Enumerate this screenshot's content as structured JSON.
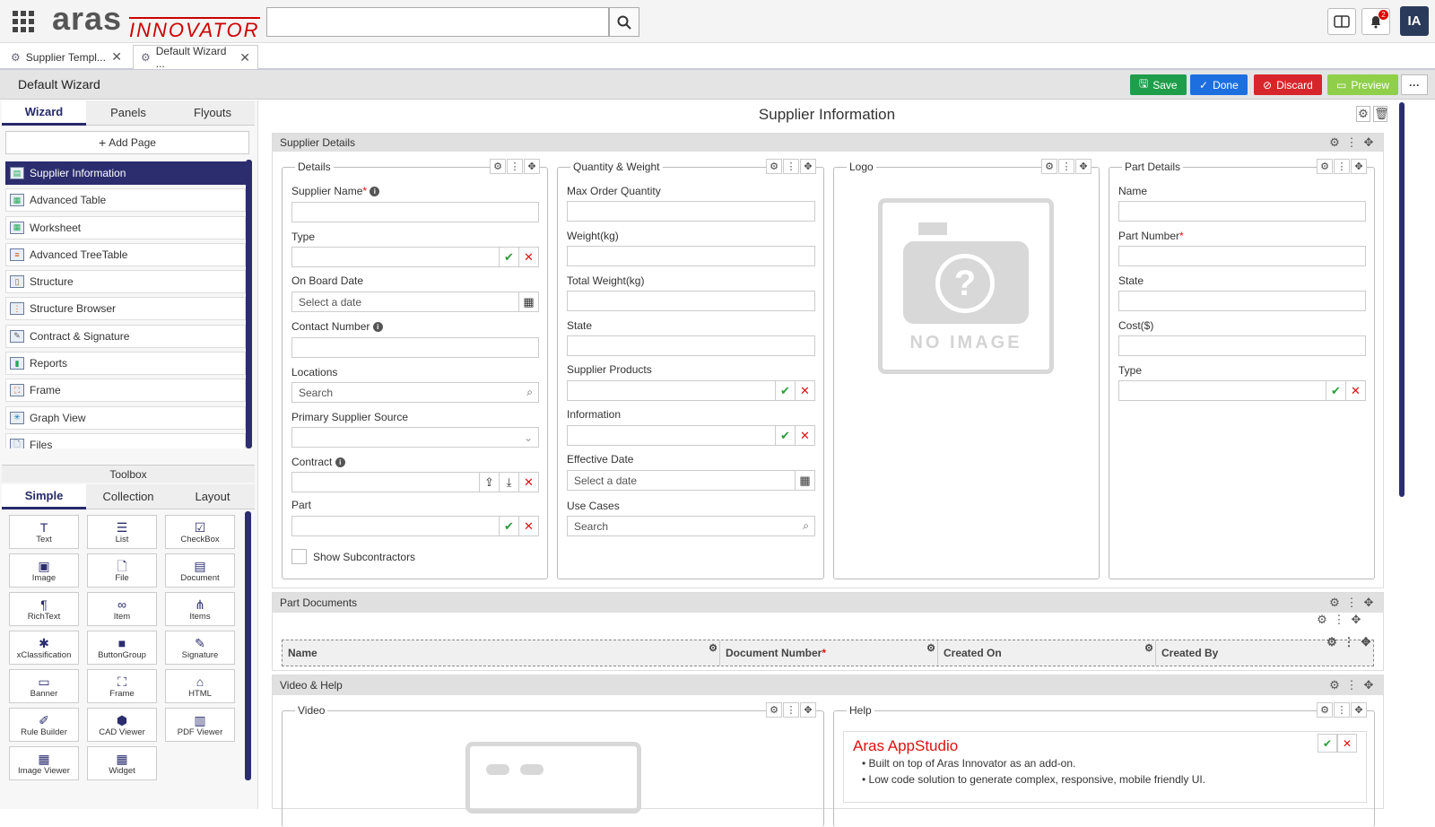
{
  "app": {
    "brand_main": "aras",
    "brand_sub": "INNOVATOR",
    "search_value": "",
    "notifications": "2",
    "user_initials": "IA"
  },
  "tabs": [
    {
      "label": "Supplier Templ..."
    },
    {
      "label": "Default Wizard ..."
    }
  ],
  "titlebar": {
    "title": "Default Wizard",
    "save": "Save",
    "done": "Done",
    "discard": "Discard",
    "preview": "Preview",
    "more": "···"
  },
  "left": {
    "tabs": [
      "Wizard",
      "Panels",
      "Flyouts"
    ],
    "add_page": "Add Page",
    "pages": [
      "Supplier Information",
      "Advanced Table",
      "Worksheet",
      "Advanced TreeTable",
      "Structure",
      "Structure Browser",
      "Contract & Signature",
      "Reports",
      "Frame",
      "Graph View",
      "Files"
    ],
    "toolbox": "Toolbox",
    "toolbox_tabs": [
      "Simple",
      "Collection",
      "Layout"
    ],
    "tools": [
      {
        "label": "Text",
        "icon": "T"
      },
      {
        "label": "List",
        "icon": "☰"
      },
      {
        "label": "CheckBox",
        "icon": "☑"
      },
      {
        "label": "Image",
        "icon": "▣"
      },
      {
        "label": "File",
        "icon": "🗋"
      },
      {
        "label": "Document",
        "icon": "▤"
      },
      {
        "label": "RichText",
        "icon": "¶"
      },
      {
        "label": "Item",
        "icon": "∞"
      },
      {
        "label": "Items",
        "icon": "⋔"
      },
      {
        "label": "xClassification",
        "icon": "✱"
      },
      {
        "label": "ButtonGroup",
        "icon": "■"
      },
      {
        "label": "Signature",
        "icon": "✎"
      },
      {
        "label": "Banner",
        "icon": "▭"
      },
      {
        "label": "Frame",
        "icon": "⛶"
      },
      {
        "label": "HTML",
        "icon": "⌂"
      },
      {
        "label": "Rule Builder",
        "icon": "✐"
      },
      {
        "label": "CAD Viewer",
        "icon": "⬢"
      },
      {
        "label": "PDF Viewer",
        "icon": "▥"
      },
      {
        "label": "Image Viewer",
        "icon": "▦"
      },
      {
        "label": "Widget",
        "icon": "▦"
      }
    ]
  },
  "main": {
    "page_title": "Supplier Information",
    "supplier_details": {
      "title": "Supplier Details",
      "details": {
        "legend": "Details",
        "supplier_name": "Supplier Name",
        "type": "Type",
        "on_board_date": "On Board Date",
        "date_placeholder": "Select a date",
        "contact_number": "Contact Number",
        "locations": "Locations",
        "search": "Search",
        "primary_source": "Primary Supplier Source",
        "contract": "Contract",
        "part": "Part",
        "show_sub": "Show Subcontractors"
      },
      "qw": {
        "legend": "Quantity & Weight",
        "max_order": "Max Order Quantity",
        "weight": "Weight(kg)",
        "total_weight": "Total Weight(kg)",
        "state": "State",
        "supplier_products": "Supplier Products",
        "information": "Information",
        "effective_date": "Effective Date",
        "date_placeholder": "Select a date",
        "use_cases": "Use Cases",
        "search": "Search"
      },
      "logo": {
        "legend": "Logo",
        "no_image": "NO IMAGE"
      },
      "part": {
        "legend": "Part Details",
        "name": "Name",
        "part_number": "Part Number",
        "state": "State",
        "cost": "Cost($)",
        "type": "Type"
      }
    },
    "part_documents": {
      "title": "Part Documents",
      "cols": [
        "Name",
        "Document Number",
        "Created On",
        "Created By"
      ]
    },
    "video_help": {
      "title": "Video & Help",
      "video": "Video",
      "help": "Help",
      "help_title": "Aras AppStudio",
      "bullets": [
        "Built on top of Aras Innovator as an add-on.",
        "Low code solution to generate complex, responsive, mobile friendly UI."
      ]
    }
  },
  "colors": {
    "save": "#1e9e4a",
    "done": "#1d6fe0",
    "discard": "#d7262b",
    "preview": "#8fcf4a",
    "nav": "#2b2d6e"
  }
}
